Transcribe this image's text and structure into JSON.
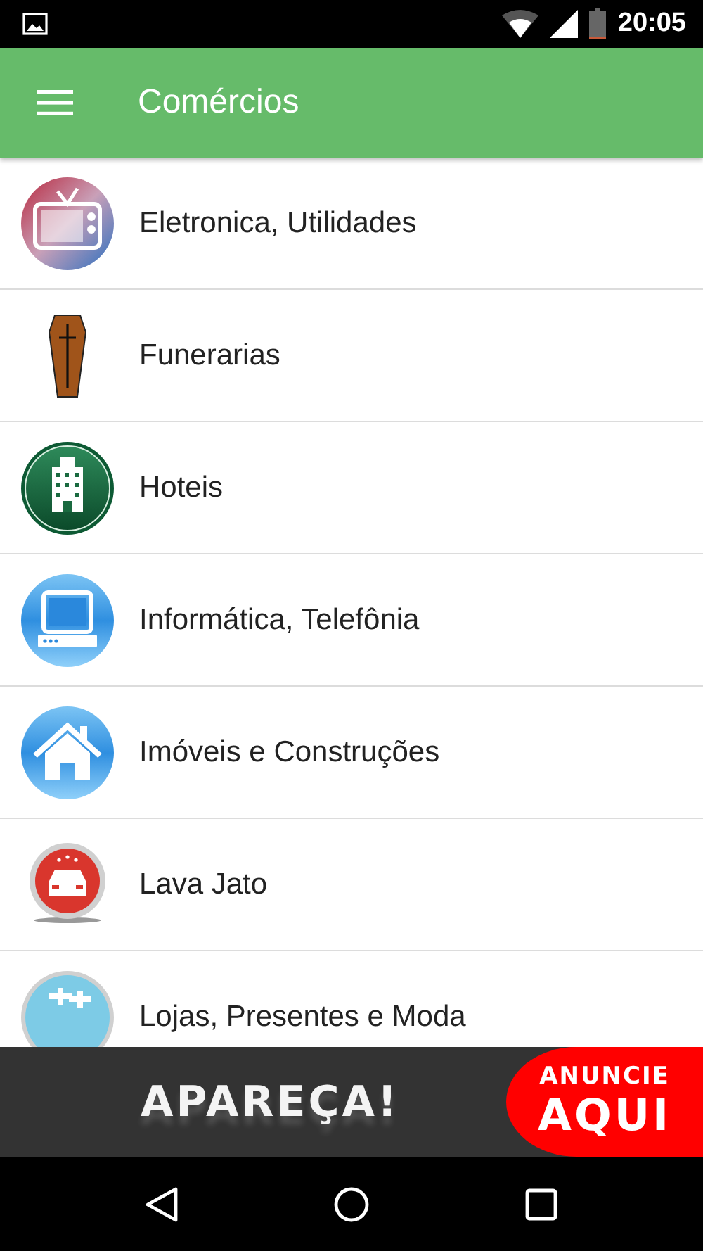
{
  "status_bar": {
    "time": "20:05"
  },
  "app_bar": {
    "title": "Comércios"
  },
  "categories": [
    {
      "label": "Eletronica, Utilidades",
      "kind": "tv"
    },
    {
      "label": "Funerarias",
      "kind": "coffin"
    },
    {
      "label": "Hoteis",
      "kind": "hotel"
    },
    {
      "label": "Informática, Telefônia",
      "kind": "computer"
    },
    {
      "label": "Imóveis e Construções",
      "kind": "house"
    },
    {
      "label": "Lava Jato",
      "kind": "carwash"
    },
    {
      "label": "Lojas, Presentes e Moda",
      "kind": "gift"
    }
  ],
  "ad_banner": {
    "headline": "APAREÇA!",
    "badge_top": "ANUNCIE",
    "badge_bottom": "AQUI"
  }
}
